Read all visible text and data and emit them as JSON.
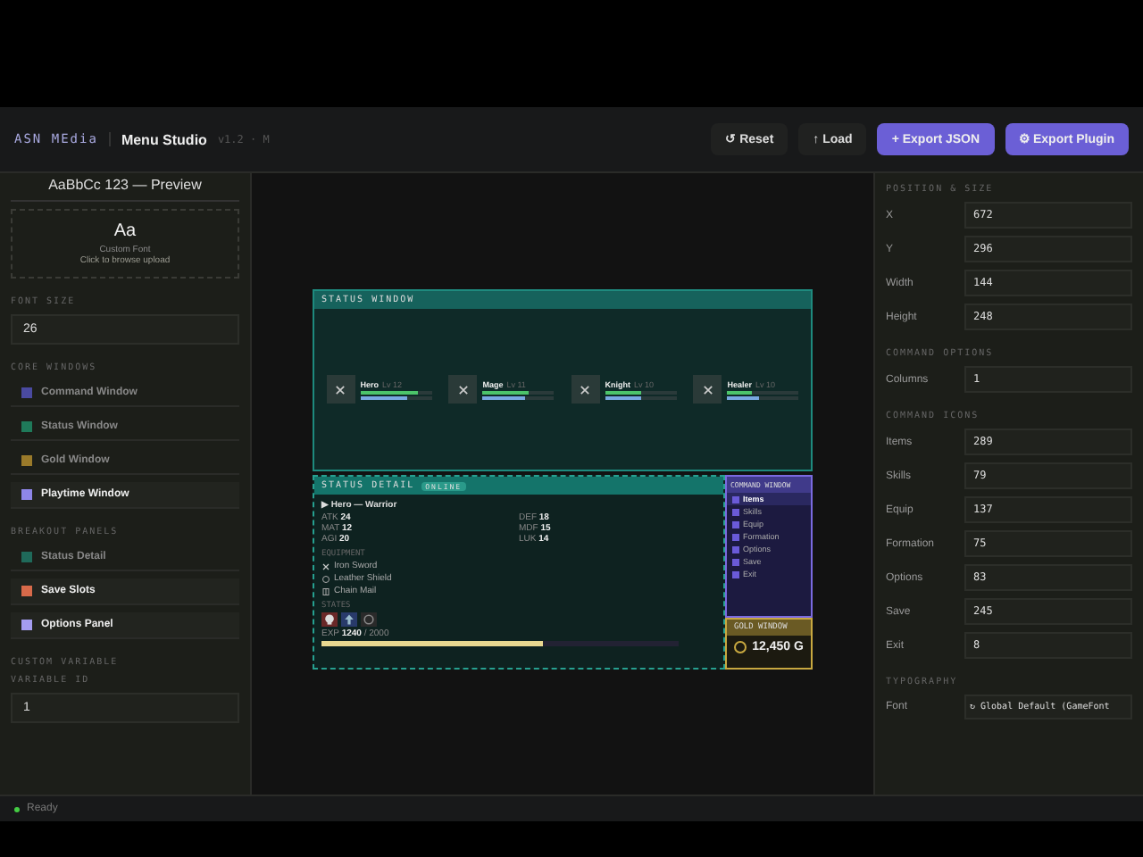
{
  "top_bar": {
    "logo": "ASN MEdia",
    "title": "Menu Studio",
    "version": "v1.2 · M",
    "buttons": [
      {
        "label": "↺ Reset",
        "kind": "ghost"
      },
      {
        "label": "↑ Load",
        "kind": "ghost"
      },
      {
        "label": "+ Export JSON",
        "kind": "primary"
      },
      {
        "label": "⚙ Export Plugin",
        "kind": "primary"
      }
    ]
  },
  "left_panel": {
    "preview_text": "AaBbCc 123 — Preview",
    "font_card": {
      "glyph": "Aa",
      "name": "Custom Font",
      "hint": "Click to browse upload"
    },
    "font_size": {
      "label": "FONT SIZE",
      "value": "26"
    },
    "core_windows": {
      "label": "CORE WINDOWS",
      "items": [
        {
          "name": "Command Window",
          "color": "#4a4aa0",
          "enabled": false
        },
        {
          "name": "Status Window",
          "color": "#1f7a5a",
          "enabled": false
        },
        {
          "name": "Gold Window",
          "color": "#9a7a2a",
          "enabled": false
        },
        {
          "name": "Playtime Window",
          "color": "#8e86e8",
          "enabled": true
        }
      ]
    },
    "breakout_panels": {
      "label": "BREAKOUT PANELS",
      "items": [
        {
          "name": "Status Detail",
          "color": "#1f6a5a",
          "enabled": false
        },
        {
          "name": "Save Slots",
          "color": "#d86a4a",
          "enabled": true
        },
        {
          "name": "Options Panel",
          "color": "#a49cf0",
          "enabled": true
        }
      ]
    },
    "custom_variable": {
      "label": "CUSTOM VARIABLE",
      "field_label": "VARIABLE ID",
      "value": "1"
    }
  },
  "canvas": {
    "status_window": {
      "title": "STATUS WINDOW",
      "actors": [
        {
          "name": "Hero",
          "lv": "Lv 12",
          "bars": [
            {
              "kind": "hp",
              "level": 0.8
            },
            {
              "kind": "mp",
              "level": 0.65
            }
          ]
        },
        {
          "name": "Mage",
          "lv": "Lv 11",
          "bars": [
            {
              "kind": "hp",
              "level": 0.65
            },
            {
              "kind": "mp",
              "level": 0.6
            }
          ]
        },
        {
          "name": "Knight",
          "lv": "Lv 10",
          "bars": [
            {
              "kind": "hp",
              "level": 0.5
            },
            {
              "kind": "mp",
              "level": 0.5
            }
          ]
        },
        {
          "name": "Healer",
          "lv": "Lv 10",
          "bars": [
            {
              "kind": "hp",
              "level": 0.35
            },
            {
              "kind": "mp",
              "level": 0.45
            }
          ]
        }
      ]
    },
    "status_detail": {
      "title": "STATUS DETAIL",
      "badge": "ONLINE",
      "heading": "▶ Hero — Warrior",
      "stats": [
        {
          "label": "ATK",
          "value": "24"
        },
        {
          "label": "DEF",
          "value": "18"
        },
        {
          "label": "MAT",
          "value": "12"
        },
        {
          "label": "MDF",
          "value": "15"
        },
        {
          "label": "AGI",
          "value": "20"
        },
        {
          "label": "LUK",
          "value": "14"
        }
      ],
      "equipment_label": "EQUIPMENT",
      "equipment": [
        {
          "kind": "sword",
          "name": "Iron Sword"
        },
        {
          "kind": "shield",
          "name": "Leather Shield"
        },
        {
          "kind": "armor",
          "name": "Chain Mail"
        }
      ],
      "states_label": "STATES",
      "states": [
        {
          "kind": "poison"
        },
        {
          "kind": "buff"
        },
        {
          "kind": "empty"
        }
      ],
      "exp": {
        "text": "EXP **1240** / 2000",
        "level": 0.62
      }
    },
    "command_window": {
      "title": "COMMAND WINDOW",
      "items": [
        {
          "label": "Items",
          "selected": true
        },
        {
          "label": "Skills",
          "selected": false
        },
        {
          "label": "Equip",
          "selected": false
        },
        {
          "label": "Formation",
          "selected": false
        },
        {
          "label": "Options",
          "selected": false
        },
        {
          "label": "Save",
          "selected": false
        },
        {
          "label": "Exit",
          "selected": false
        }
      ]
    },
    "gold_window": {
      "title": "GOLD WINDOW",
      "amount": "12,450 G"
    }
  },
  "right_panel": {
    "sections": [
      {
        "title": "POSITION & SIZE",
        "fields": [
          {
            "label": "X",
            "value": "672"
          },
          {
            "label": "Y",
            "value": "296"
          },
          {
            "label": "Width",
            "value": "144"
          },
          {
            "label": "Height",
            "value": "248"
          }
        ]
      },
      {
        "title": "COMMAND OPTIONS",
        "fields": [
          {
            "label": "Columns",
            "value": "1"
          }
        ]
      },
      {
        "title": "COMMAND ICONS",
        "fields": [
          {
            "label": "Items",
            "value": "289"
          },
          {
            "label": "Skills",
            "value": "79"
          },
          {
            "label": "Equip",
            "value": "137"
          },
          {
            "label": "Formation",
            "value": "75"
          },
          {
            "label": "Options",
            "value": "83"
          },
          {
            "label": "Save",
            "value": "245"
          },
          {
            "label": "Exit",
            "value": "8"
          }
        ]
      },
      {
        "title": "TYPOGRAPHY",
        "fields": [
          {
            "label": "Font",
            "value": "↻ Global Default (GameFont"
          }
        ]
      }
    ]
  },
  "status_bar": {
    "state": "Ready"
  }
}
